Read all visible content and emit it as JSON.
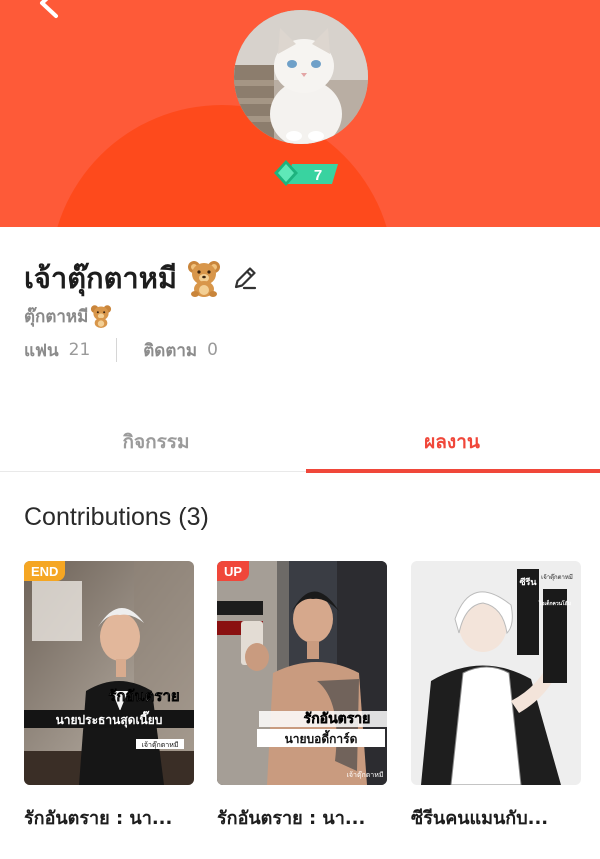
{
  "colors": {
    "header_bg": "#fe5a38",
    "header_arc": "#fe4a1c",
    "accent": "#f0473a",
    "badge_end": "#f5a623",
    "badge_up": "#f0473a",
    "level_badge": "#2ecc8f"
  },
  "header": {
    "back_icon": "chevron-left-icon",
    "level": "7"
  },
  "profile": {
    "name": "เจ้าตุ๊กตาหมี",
    "name_emoji_icon": "teddy-bear-icon",
    "edit_icon": "pencil-icon",
    "handle": "ตุ๊กตาหมี",
    "fans_label": "แฟน",
    "fans_count": "21",
    "following_label": "ติดตาม",
    "following_count": "0"
  },
  "tabs": [
    {
      "label": "กิจกรรม",
      "active": false
    },
    {
      "label": "ผลงาน",
      "active": true
    }
  ],
  "contributions": {
    "title": "Contributions (3)",
    "items": [
      {
        "badge": "END",
        "title": "รักอันตราย : นา...",
        "cover_text_1": "รักอันตราย",
        "cover_text_2": "นายประธานสุดเนี๊ยบ",
        "cover_author": "เจ้าตุ๊กตาหมี"
      },
      {
        "badge": "UP",
        "title": "รักอันตราย : นา...",
        "cover_text_1": "รักอันตราย",
        "cover_text_2": "นายบอดี้การ์ด",
        "cover_author": "เจ้าตุ๊กตาหมี"
      },
      {
        "badge": "",
        "title": "ซีรีนคนแมนกับ...",
        "cover_text_1": "ซีรีน",
        "cover_text_2": "ไอเด็กควนโอ๊ม",
        "cover_author": "เจ้าตุ๊กตาหมี"
      }
    ]
  }
}
